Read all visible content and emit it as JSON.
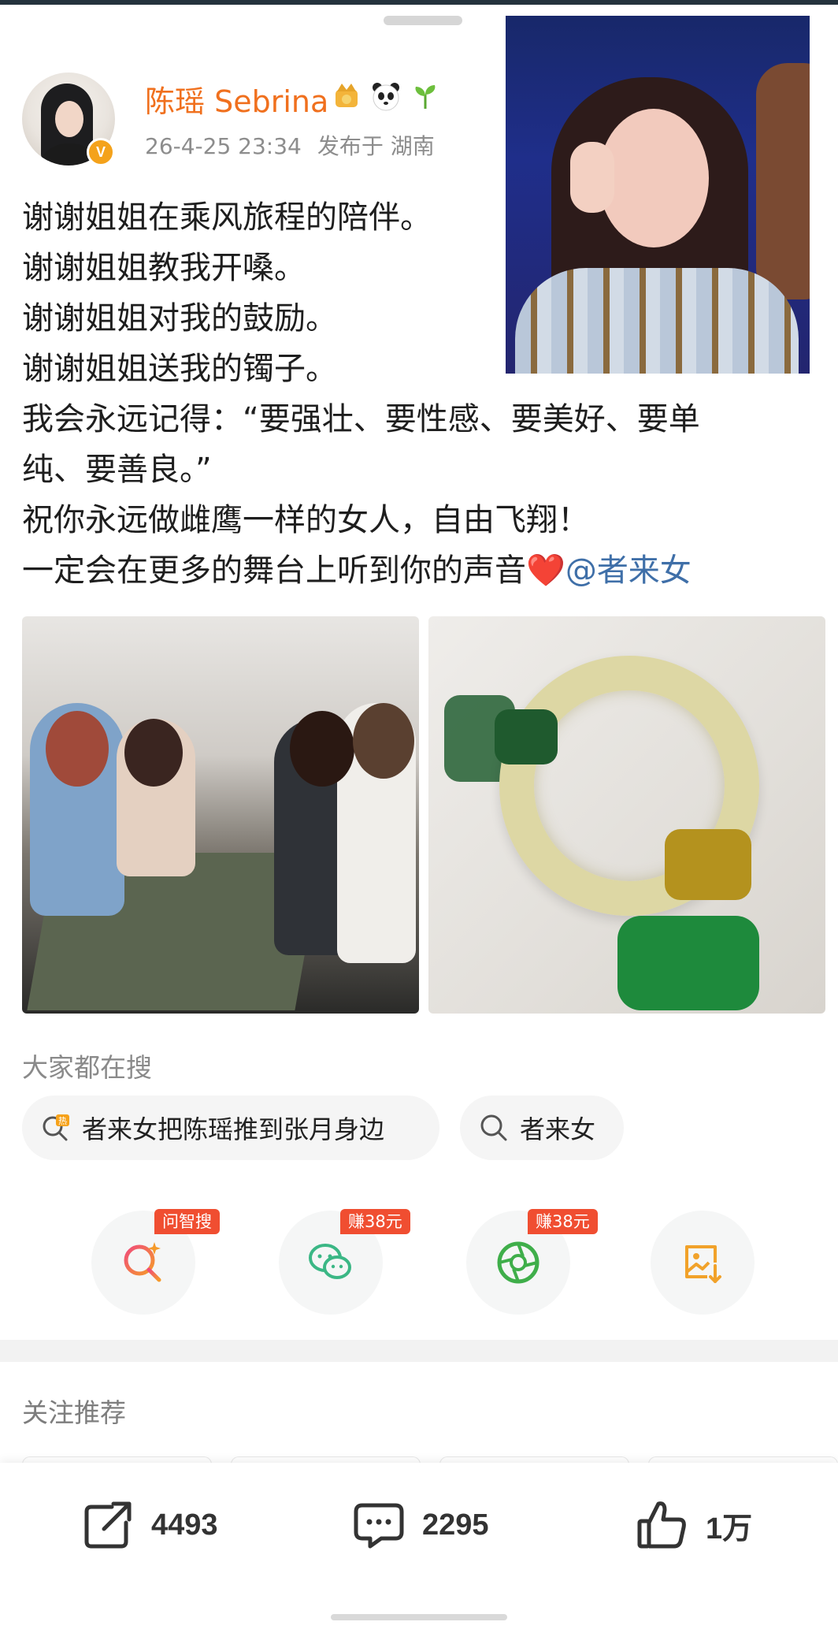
{
  "post": {
    "author": {
      "name": "陈瑶 Sebrina",
      "badge": "V",
      "emojis": [
        "crown-icon",
        "panda-icon",
        "sprout-icon"
      ]
    },
    "time": "26-4-25 23:34",
    "location": "发布于 湖南",
    "text_lines": [
      "谢谢姐姐在乘风旅程的陪伴。",
      "谢谢姐姐教我开嗓。",
      "谢谢姐姐对我的鼓励。",
      "谢谢姐姐送我的镯子。",
      "我会永远记得：“要强壮、要性感、要美好、要单",
      "纯、要善良。”",
      "祝你永远做雌鹰一样的女人，自由飞翔！",
      "一定会在更多的舞台上听到你的声音"
    ],
    "heart": "❤️",
    "mention": "@者来女"
  },
  "search": {
    "title": "大家都在搜",
    "items": [
      {
        "label": "者来女把陈瑶推到张月身边",
        "icon": "hot-search-icon"
      },
      {
        "label": "者来女",
        "icon": "search-icon"
      }
    ]
  },
  "actions": [
    {
      "tag": "问智搜",
      "icon": "ai-search-icon"
    },
    {
      "tag": "赚38元",
      "icon": "wechat-icon"
    },
    {
      "tag": "赚38元",
      "icon": "moments-icon"
    },
    {
      "tag": "",
      "icon": "save-image-icon"
    }
  ],
  "follow": {
    "title": "关注推荐"
  },
  "stats": {
    "share": "4493",
    "comment": "2295",
    "like": "1万"
  },
  "colors": {
    "username": "#f0701e",
    "mention": "#3f6fa8",
    "tag": "#f04e31",
    "wechat": "#3bb785",
    "moments": "#3fae4a",
    "save": "#f1a22a"
  }
}
